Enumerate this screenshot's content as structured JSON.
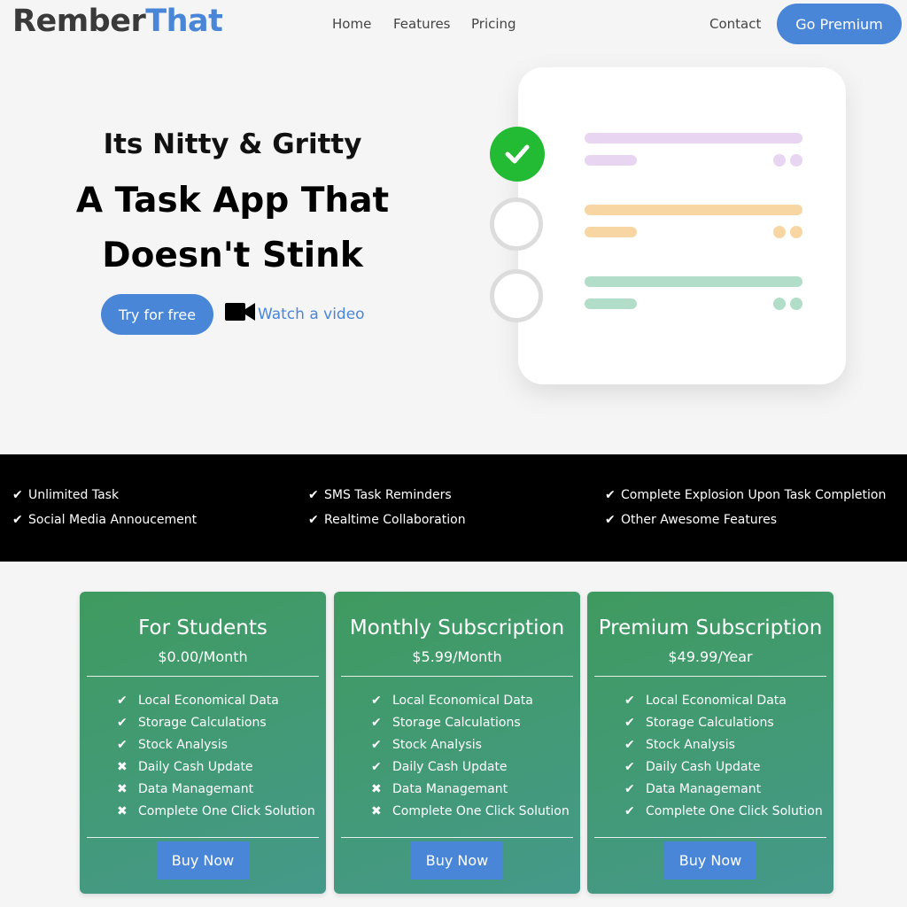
{
  "nav": {
    "logo_part1": "Rember",
    "logo_part2": "That",
    "links": [
      "Home",
      "Features",
      "Pricing"
    ],
    "contact": "Contact",
    "cta": "Go Premium"
  },
  "hero": {
    "subtitle": "Its Nitty & Gritty",
    "title_line1": "A Task App That",
    "title_line2": "Doesn't Stink",
    "try_button": "Try for free",
    "video_icon": "video-camera-icon",
    "watch_link": "Watch a video"
  },
  "task_card": {
    "items": [
      {
        "state": "done",
        "color": "#e8d5f2"
      },
      {
        "state": "open",
        "color": "#f7d6a3"
      },
      {
        "state": "open",
        "color": "#b2ddc8"
      }
    ],
    "done_color": "#22bb33"
  },
  "features": [
    "Unlimited Task",
    "SMS Task Reminders",
    "Complete Explosion Upon Task Completion",
    "Social Media Annoucement",
    "Realtime Collaboration",
    "Other Awesome Features"
  ],
  "plans": [
    {
      "name": "For Students",
      "price": "$0.00/Month",
      "features": [
        {
          "label": "Local Economical Data",
          "included": true
        },
        {
          "label": "Storage Calculations",
          "included": true
        },
        {
          "label": "Stock Analysis",
          "included": true
        },
        {
          "label": "Daily Cash Update",
          "included": false
        },
        {
          "label": "Data Managemant",
          "included": false
        },
        {
          "label": "Complete One Click Solution",
          "included": false
        }
      ],
      "button": "Buy Now"
    },
    {
      "name": "Monthly Subscription",
      "price": "$5.99/Month",
      "features": [
        {
          "label": "Local Economical Data",
          "included": true
        },
        {
          "label": "Storage Calculations",
          "included": true
        },
        {
          "label": "Stock Analysis",
          "included": true
        },
        {
          "label": "Daily Cash Update",
          "included": true
        },
        {
          "label": "Data Managemant",
          "included": false
        },
        {
          "label": "Complete One Click Solution",
          "included": false
        }
      ],
      "button": "Buy Now"
    },
    {
      "name": "Premium Subscription",
      "price": "$49.99/Year",
      "features": [
        {
          "label": "Local Economical Data",
          "included": true
        },
        {
          "label": "Storage Calculations",
          "included": true
        },
        {
          "label": "Stock Analysis",
          "included": true
        },
        {
          "label": "Daily Cash Update",
          "included": true
        },
        {
          "label": "Data Managemant",
          "included": true
        },
        {
          "label": "Complete One Click Solution",
          "included": true
        }
      ],
      "button": "Buy Now"
    }
  ],
  "colors": {
    "brand_blue": "#4a86d8",
    "logo_dark": "#3a3a3a",
    "band_bg": "#000000",
    "plan_green": "#3f9a5f"
  }
}
